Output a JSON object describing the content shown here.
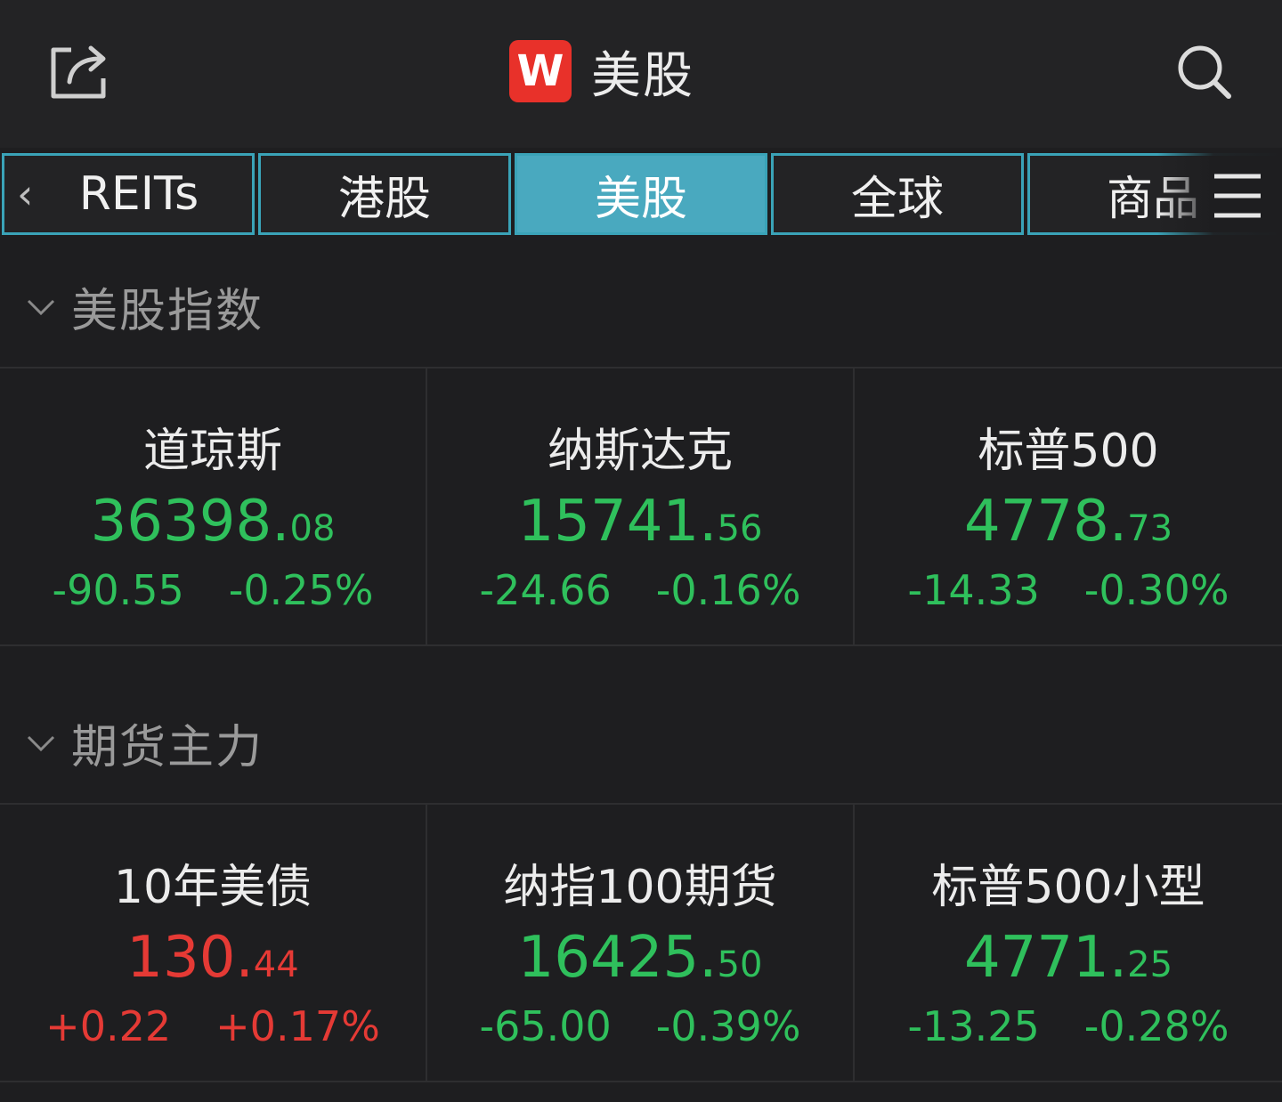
{
  "header": {
    "logo_text": "W",
    "title": "美股",
    "share_icon": "share-icon",
    "search_icon": "search-icon"
  },
  "tabs": [
    {
      "label": "REITs",
      "active": false
    },
    {
      "label": "港股",
      "active": false
    },
    {
      "label": "美股",
      "active": true
    },
    {
      "label": "全球",
      "active": false
    },
    {
      "label": "商品",
      "active": false
    }
  ],
  "tab_back_glyph": "‹",
  "colors": {
    "up": "#e53a35",
    "down": "#2fc05c",
    "accent": "#49a9bf",
    "logo": "#e8312a"
  },
  "indices": {
    "title": "美股指数",
    "items": [
      {
        "name": "道琼斯",
        "price_int": "36398.",
        "price_dec": "08",
        "change": "-90.55",
        "pct": "-0.25%",
        "dir": "down"
      },
      {
        "name": "纳斯达克",
        "price_int": "15741.",
        "price_dec": "56",
        "change": "-24.66",
        "pct": "-0.16%",
        "dir": "down"
      },
      {
        "name": "标普500",
        "price_int": "4778.",
        "price_dec": "73",
        "change": "-14.33",
        "pct": "-0.30%",
        "dir": "down"
      }
    ]
  },
  "futures": {
    "title": "期货主力",
    "items": [
      {
        "name": "10年美债",
        "price_int": "130.",
        "price_dec": "44",
        "change": "+0.22",
        "pct": "+0.17%",
        "dir": "up"
      },
      {
        "name": "纳指100期货",
        "price_int": "16425.",
        "price_dec": "50",
        "change": "-65.00",
        "pct": "-0.39%",
        "dir": "down"
      },
      {
        "name": "标普500小型",
        "price_int": "4771.",
        "price_dec": "25",
        "change": "-13.25",
        "pct": "-0.28%",
        "dir": "down"
      }
    ]
  }
}
